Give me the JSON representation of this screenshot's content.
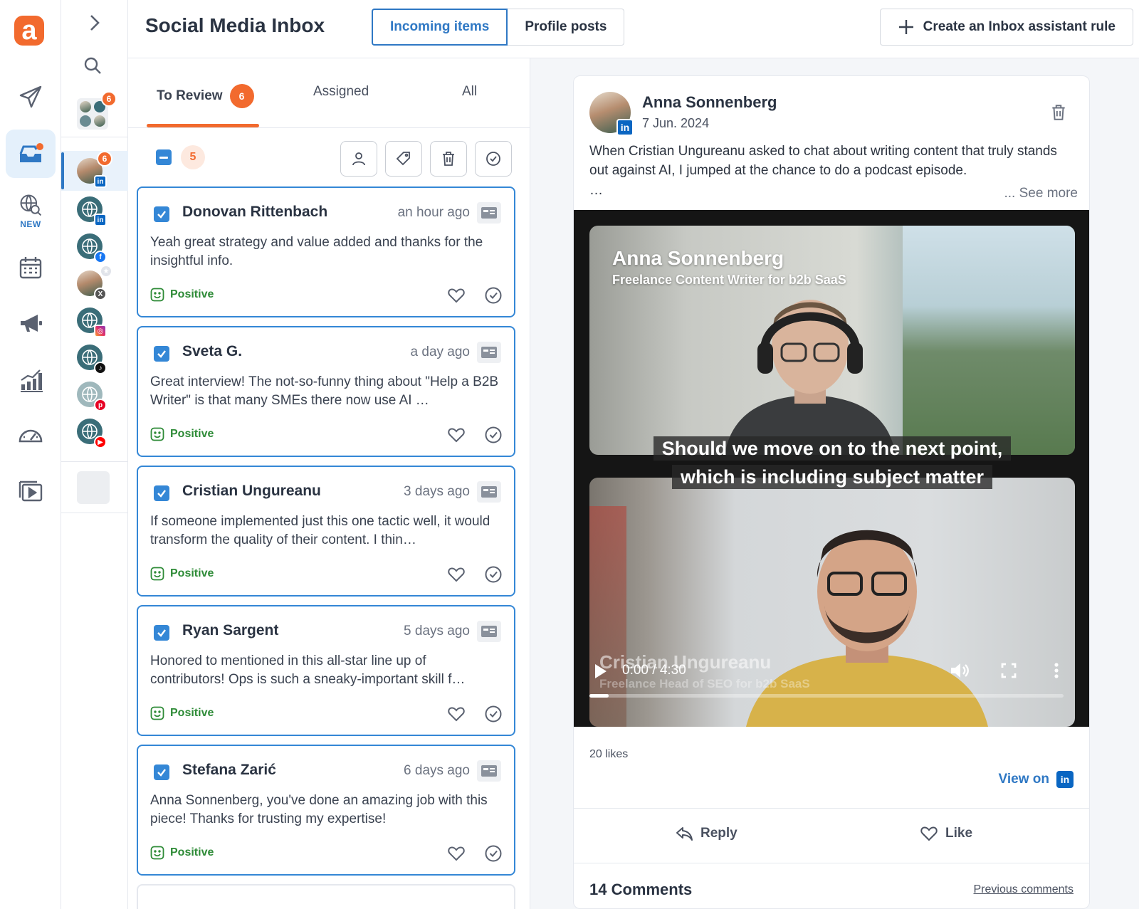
{
  "app": {
    "logo_letter": "a",
    "brand_color": "#f26a2e",
    "accent_color": "#2f78c4"
  },
  "nav": {
    "items": [
      {
        "icon": "paper-plane-icon",
        "label": ""
      },
      {
        "icon": "inbox-icon",
        "label": "",
        "active": true
      },
      {
        "icon": "globe-search-icon",
        "label": "NEW"
      },
      {
        "icon": "calendar-icon",
        "label": ""
      },
      {
        "icon": "megaphone-icon",
        "label": ""
      },
      {
        "icon": "bar-chart-icon",
        "label": ""
      },
      {
        "icon": "gauge-icon",
        "label": ""
      },
      {
        "icon": "video-library-icon",
        "label": ""
      }
    ]
  },
  "accounts": {
    "all_badge": "6",
    "items": [
      {
        "network": "linkedin",
        "badge": "6",
        "selected": true
      },
      {
        "network": "linkedin"
      },
      {
        "network": "facebook"
      },
      {
        "network": "x"
      },
      {
        "network": "instagram"
      },
      {
        "network": "tiktok"
      },
      {
        "network": "pinterest"
      },
      {
        "network": "youtube"
      }
    ]
  },
  "header": {
    "title": "Social Media Inbox",
    "segments": [
      "Incoming items",
      "Profile posts"
    ],
    "active_segment": "Incoming items",
    "create_rule_label": "Create an Inbox assistant rule"
  },
  "list": {
    "tabs": [
      {
        "label": "To Review",
        "badge": "6"
      },
      {
        "label": "Assigned"
      },
      {
        "label": "All"
      }
    ],
    "selected_count": "5",
    "items": [
      {
        "name": "Donovan Rittenbach",
        "time": "an hour ago",
        "text": "Yeah great strategy and value added and thanks for the insightful info.",
        "sentiment": "Positive"
      },
      {
        "name": "Sveta G.",
        "time": "a day ago",
        "text": "Great interview! The not-so-funny thing about \"Help a B2B Writer\" is that many SMEs there now use AI …",
        "sentiment": "Positive"
      },
      {
        "name": "Cristian Ungureanu",
        "time": "3 days ago",
        "text": "If someone implemented just this one tactic well, it would transform the quality of their content. I thin…",
        "sentiment": "Positive"
      },
      {
        "name": "Ryan Sargent",
        "time": "5 days ago",
        "text": "Honored to mentioned in this all-star line up of contributors! Ops is such a sneaky-important skill f…",
        "sentiment": "Positive"
      },
      {
        "name": "Stefana Zarić",
        "time": "6 days ago",
        "text": "Anna Sonnenberg, you've done an amazing job with this piece! Thanks for trusting my expertise!",
        "sentiment": "Positive"
      }
    ]
  },
  "post": {
    "author": "Anna Sonnenberg",
    "date": "7 Jun. 2024",
    "text": "When Cristian Ungureanu asked to chat about writing content that truly stands out against AI, I jumped at the chance to do a podcast episode.",
    "ellipsis": "…",
    "see_more": "... See more",
    "video": {
      "top_name": "Anna Sonnenberg",
      "top_role": "Freelance Content Writer for b2b SaaS",
      "caption_line1": "Should we move on to the next point,",
      "caption_line2": "which is including subject matter",
      "bottom_name": "Cristian Ungureanu",
      "bottom_role": "Freelance Head of SEO for b2b SaaS",
      "time": "0:00 / 4:30",
      "progress": 0.04
    },
    "likes": "20 likes",
    "view_on_label": "View on",
    "reply_label": "Reply",
    "like_label": "Like",
    "comments_count": "14 Comments",
    "previous_comments": "Previous comments"
  }
}
